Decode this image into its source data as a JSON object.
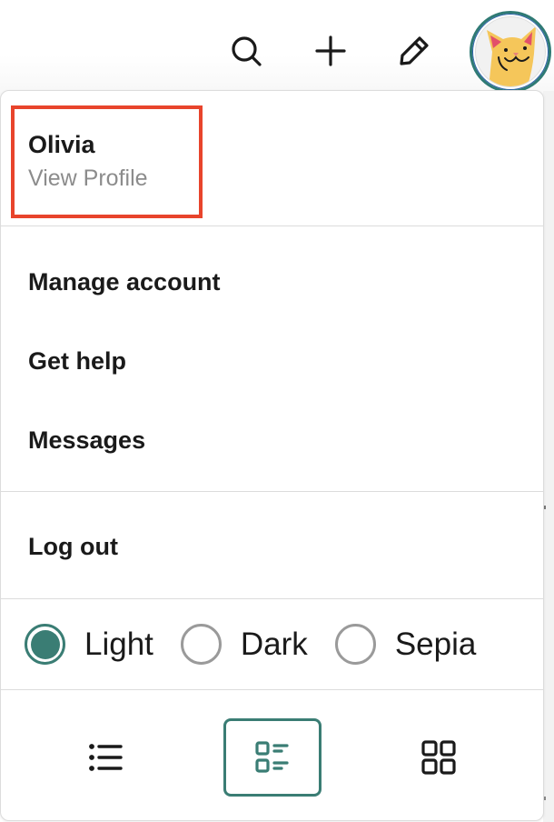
{
  "topbar": {
    "icons": [
      {
        "name": "search-icon",
        "label": "Search"
      },
      {
        "name": "plus-icon",
        "label": "Create"
      },
      {
        "name": "pencil-icon",
        "label": "Edit"
      }
    ],
    "avatar": {
      "name": "cat-avatar",
      "label": "Olivia"
    }
  },
  "dropdown": {
    "profile": {
      "name": "Olivia",
      "link": "View Profile"
    },
    "menu": [
      {
        "label": "Manage account"
      },
      {
        "label": "Get help"
      },
      {
        "label": "Messages"
      }
    ],
    "logout": {
      "label": "Log out"
    },
    "theme": {
      "options": [
        {
          "label": "Light",
          "checked": true
        },
        {
          "label": "Dark",
          "checked": false
        },
        {
          "label": "Sepia",
          "checked": false
        }
      ],
      "selected": "Light"
    },
    "view_modes": [
      {
        "name": "list-view",
        "active": false
      },
      {
        "name": "compact-list-view",
        "active": true
      },
      {
        "name": "grid-view",
        "active": false
      }
    ]
  },
  "colors": {
    "accent": "#3a7d74",
    "highlight": "#e8442c",
    "muted_text": "#8c8c8c",
    "text": "#1a1a1a"
  }
}
